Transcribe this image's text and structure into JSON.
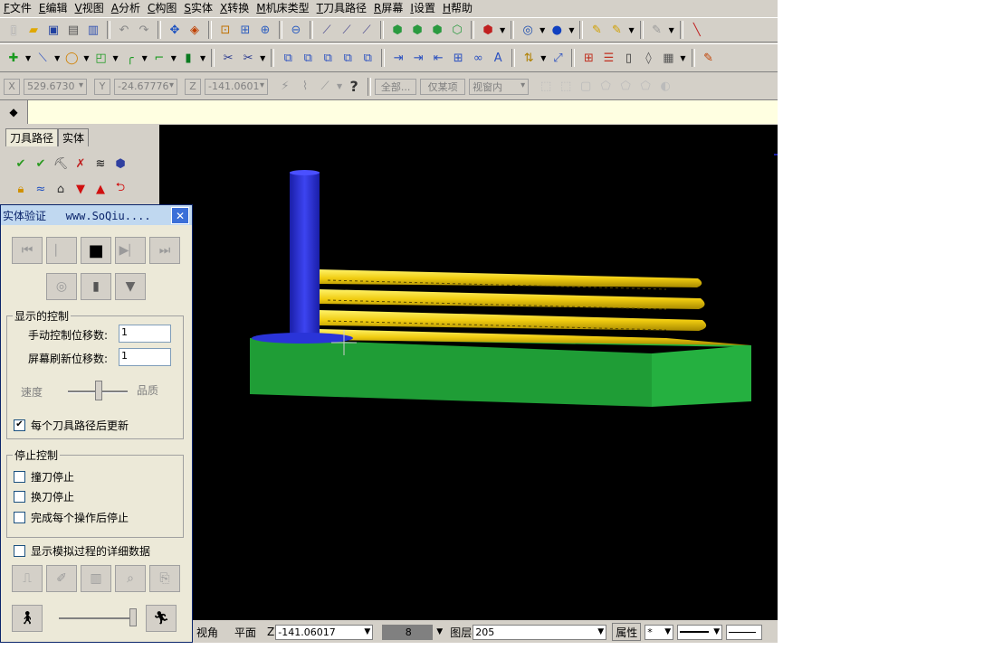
{
  "menu": [
    {
      "key": "F",
      "label": "文件"
    },
    {
      "key": "E",
      "label": "编辑"
    },
    {
      "key": "V",
      "label": "视图"
    },
    {
      "key": "A",
      "label": "分析"
    },
    {
      "key": "C",
      "label": "构图"
    },
    {
      "key": "S",
      "label": "实体"
    },
    {
      "key": "X",
      "label": "转换"
    },
    {
      "key": "M",
      "label": "机床类型"
    },
    {
      "key": "T",
      "label": "刀具路径"
    },
    {
      "key": "R",
      "label": "屏幕"
    },
    {
      "key": "I",
      "label": "设置"
    },
    {
      "key": "H",
      "label": "帮助"
    }
  ],
  "coordbar": {
    "x_label": "X",
    "x_value": "529.6730",
    "y_label": "Y",
    "y_value": "-24.67776",
    "z_label": "Z",
    "z_value": "-141.0601",
    "all_label": "全部...",
    "some_label": "仅某项",
    "view_label": "视窗内"
  },
  "manager": {
    "tab_toolpath": "刀具路径",
    "tab_solid": "实体"
  },
  "dialog": {
    "title": "实体验证   www.SoQiu....",
    "display_group": "显示的控制",
    "manual_step_label": "手动控制位移数:",
    "manual_step_value": "1",
    "refresh_step_label": "屏幕刷新位移数:",
    "refresh_step_value": "1",
    "speed_label": "速度",
    "quality_label": "品质",
    "update_each_label": "每个刀具路径后更新",
    "update_each_checked": "✔",
    "stop_group": "停止控制",
    "stop_collision": "撞刀停止",
    "stop_toolchange": "换刀停止",
    "stop_each_op": "完成每个操作后停止",
    "show_details": "显示模拟过程的详细数据"
  },
  "statusbar": {
    "view_label": "视角",
    "plane_label": "平面",
    "z_label": "Z",
    "z_value": "-141.06017",
    "color_value": "8",
    "layer_label": "图层",
    "layer_value": "205",
    "attr_label": "属性",
    "point_style": "*"
  },
  "colors": {
    "stock": "#1fa337",
    "toolpath": "#f0d21e",
    "tool": "#2a2ed8",
    "viewport_bg": "#000000"
  }
}
